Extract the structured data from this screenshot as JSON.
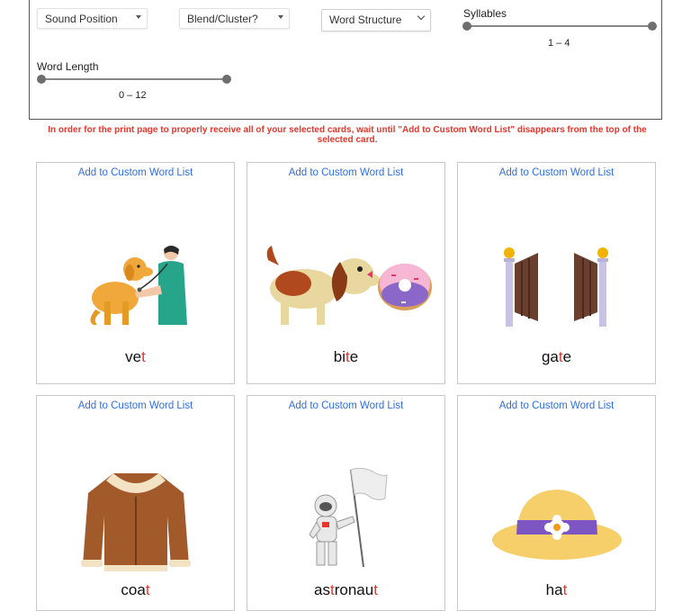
{
  "filters": {
    "sound_position": "Sound Position",
    "blend_cluster": "Blend/Cluster?",
    "word_structure": "Word Structure",
    "syllables": {
      "label": "Syllables",
      "min": 1,
      "max": 4,
      "range_text": "1 – 4"
    },
    "word_length": {
      "label": "Word Length",
      "min": 0,
      "max": 12,
      "range_text": "0 – 12"
    }
  },
  "notice": "In order for the print page to properly receive all of your selected cards, wait until \"Add to Custom Word List\" disappears from the top of the selected card.",
  "cards": [
    {
      "add_label": "Add to Custom Word List",
      "word_pre": "ve",
      "word_hl": "t",
      "word_post": "",
      "image": "vet-icon"
    },
    {
      "add_label": "Add to Custom Word List",
      "word_pre": "bi",
      "word_hl": "t",
      "word_post": "e",
      "image": "dog-biting-donut-icon"
    },
    {
      "add_label": "Add to Custom Word List",
      "word_pre": "ga",
      "word_hl": "t",
      "word_post": "e",
      "image": "gate-icon"
    },
    {
      "add_label": "Add to Custom Word List",
      "word_pre": "coa",
      "word_hl": "t",
      "word_post": "",
      "image": "coat-icon"
    },
    {
      "add_label": "Add to Custom Word List",
      "word_pre": "as",
      "word_hl": "t",
      "word_mid": "ronau",
      "word_hl2": "t",
      "word_post": "",
      "image": "astronaut-icon"
    },
    {
      "add_label": "Add to Custom Word List",
      "word_pre": "ha",
      "word_hl": "t",
      "word_post": "",
      "image": "hat-icon"
    }
  ],
  "colors": {
    "accent_link": "#2f6ee0",
    "highlight": "#e8342a"
  }
}
